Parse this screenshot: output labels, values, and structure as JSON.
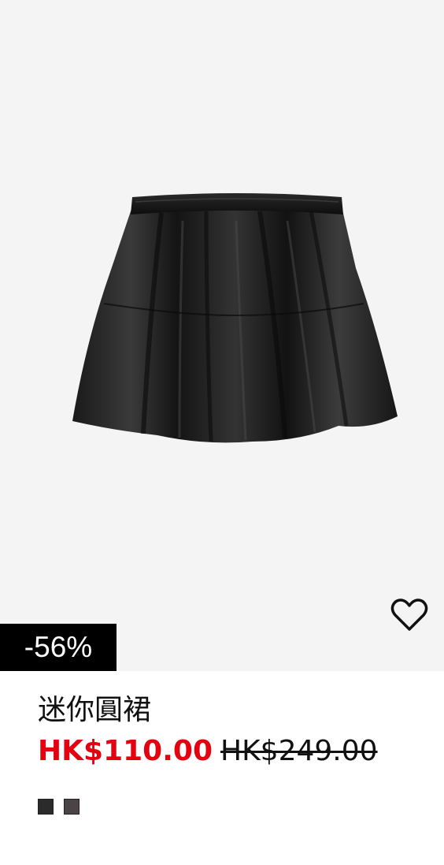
{
  "product": {
    "title": "迷你圓裙",
    "discount_badge": "-56%",
    "sale_price": "HK$110.00",
    "original_price": "HK$249.00",
    "image_icon": "black-leather-mini-skirt-image",
    "wishlist_icon": "heart-outline-icon",
    "colors": {
      "sale_price": "#e50010",
      "badge_bg": "#000000",
      "image_bg": "#f4f4f4"
    },
    "swatches": [
      {
        "name": "black",
        "color": "#2b2b2b"
      },
      {
        "name": "dark-grey",
        "color": "#4a4446"
      }
    ]
  }
}
